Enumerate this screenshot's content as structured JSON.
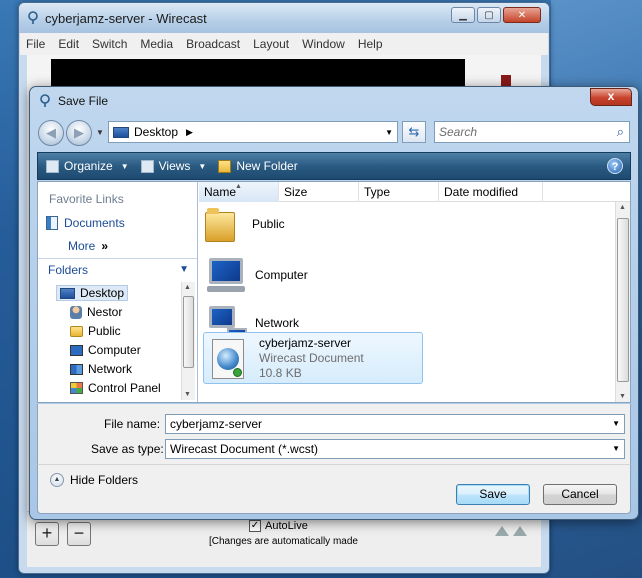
{
  "background_window": {
    "title": "cyberjamz-server - Wirecast",
    "menu": [
      "File",
      "Edit",
      "Switch",
      "Media",
      "Broadcast",
      "Layout",
      "Window",
      "Help"
    ],
    "add_symbol": "+",
    "remove_symbol": "−",
    "autolive_label": "AutoLive",
    "autolive_checked": true,
    "autolive_note": "[Changes are automatically made"
  },
  "dialog": {
    "title": "Save File",
    "close_symbol": "x",
    "address": {
      "location": "Desktop"
    },
    "search": {
      "placeholder": "Search"
    },
    "toolbar": {
      "organize": "Organize",
      "views": "Views",
      "new_folder": "New Folder",
      "help_symbol": "?"
    },
    "navigation": {
      "favorite_links_header": "Favorite Links",
      "favorites": [
        {
          "label": "Documents",
          "icon": "documents-icon"
        }
      ],
      "more_label": "More",
      "folders_header": "Folders",
      "tree": [
        {
          "label": "Desktop",
          "icon": "desktop-icon",
          "selected": true
        },
        {
          "label": "Nestor",
          "icon": "user-folder-icon"
        },
        {
          "label": "Public",
          "icon": "folder-icon"
        },
        {
          "label": "Computer",
          "icon": "computer-icon"
        },
        {
          "label": "Network",
          "icon": "network-icon"
        },
        {
          "label": "Control Panel",
          "icon": "control-panel-icon"
        }
      ]
    },
    "columns": [
      "Name",
      "Size",
      "Type",
      "Date modified"
    ],
    "items": [
      {
        "name": "Public",
        "icon": "folder-icon"
      },
      {
        "name": "Computer",
        "icon": "computer-icon"
      },
      {
        "name": "Network",
        "icon": "network-icon"
      }
    ],
    "selected_file": {
      "name": "cyberjamz-server",
      "type": "Wirecast Document",
      "size": "10.8 KB"
    },
    "file_name_label": "File name:",
    "file_name_value": "cyberjamz-server",
    "save_as_type_label": "Save as type:",
    "save_as_type_value": "Wirecast Document (*.wcst)",
    "hide_folders_label": "Hide Folders",
    "save_button": "Save",
    "cancel_button": "Cancel"
  },
  "colors": {
    "toolbar": "#2b5b82",
    "link": "#1c4c96",
    "selection": "#d6ecfc",
    "close_button": "#c8432c"
  }
}
